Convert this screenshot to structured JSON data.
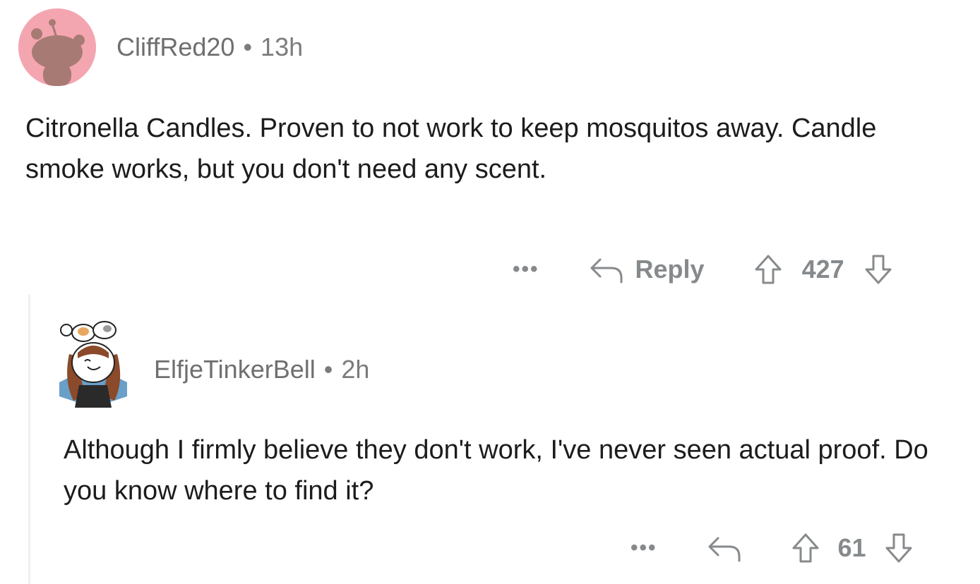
{
  "comment": {
    "author": "CliffRed20",
    "separator": "•",
    "age": "13h",
    "body": "Citronella Candles. Proven to not work to keep mosquitos away. Candle smoke works, but you don't need any scent.",
    "more_label": "•••",
    "reply_label": "Reply",
    "score": "427",
    "avatar_color": "#f4a6b0"
  },
  "reply": {
    "author": "ElfjeTinkerBell",
    "separator": "•",
    "age": "2h",
    "body": "Although I firmly believe they don't work, I've never seen actual proof. Do you know where to find it?",
    "more_label": "•••",
    "score": "61"
  },
  "icons": {
    "reply": "reply-arrow-icon",
    "upvote": "upvote-arrow-icon",
    "downvote": "downvote-arrow-icon"
  }
}
